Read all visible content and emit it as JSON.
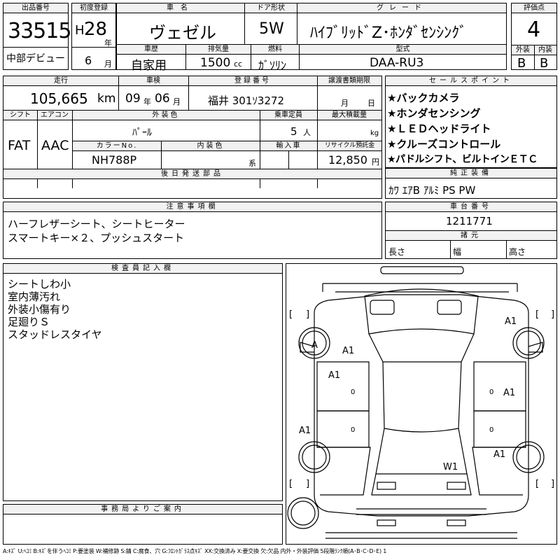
{
  "header_row": {
    "lot_no_label": "出品番号",
    "lot_no": "33515",
    "first_reg_label": "初度登録",
    "era": "H",
    "year": "28",
    "year_unit": "年",
    "month": "6",
    "month_unit": "月",
    "debut": "中部デビュー",
    "car_name_label": "車名",
    "car_name": "ヴェゼル",
    "door_label": "ドア形状",
    "door": "5W",
    "grade_label": "グレード",
    "grade": "ﾊｲﾌﾞﾘｯﾄﾞZ･ﾎﾝﾀﾞｾﾝｼﾝｸﾞ",
    "score_label": "評価点",
    "score": "4",
    "history_label": "車歴",
    "history": "自家用",
    "displacement_label": "排気量",
    "displacement": "1500",
    "displacement_unit": "cc",
    "fuel_label": "燃料",
    "fuel": "ｶﾞｿﾘﾝ",
    "model_label": "型式",
    "model": "DAA-RU3",
    "exterior_label": "外装",
    "exterior": "B",
    "interior_label": "内装",
    "interior": "B"
  },
  "second_block": {
    "mileage_label": "走行",
    "mileage": "105,665",
    "mileage_unit": "km",
    "inspection_label": "車検",
    "insp_year": "09",
    "insp_year_unit": "年",
    "insp_month": "06",
    "insp_month_unit": "月",
    "reg_no_label": "登録番号",
    "reg_no": "福井 301ｿ3272",
    "doc_deadline_label": "譲渡書類期限",
    "doc_month_unit": "月",
    "doc_day_unit": "日",
    "shift_label": "シフト",
    "shift": "FAT",
    "ac_label": "エアコン",
    "ac": "AAC",
    "ext_color_label": "外装色",
    "ext_color": "ﾊﾟｰﾙ",
    "capacity_label": "乗車定員",
    "capacity": "5",
    "capacity_unit": "人",
    "max_load_label": "最大積載量",
    "max_load_unit": "kg",
    "color_no_label": "カラーNo.",
    "color_no": "NH788P",
    "int_color_label": "内装色",
    "int_color_unit": "系",
    "import_label": "輸入車",
    "recycle_label": "リサイクル預託金",
    "recycle": "12,850",
    "recycle_unit": "円",
    "later_parts_label": "後日発送部品"
  },
  "sales_points": {
    "label": "セールスポイント",
    "items": [
      "★バックカメラ",
      "★ホンダセンシング",
      "★ＬＥＤヘッドライト",
      "★クルーズコントロール",
      "★パドルシフト、ビルトインＥＴＣ"
    ]
  },
  "equipment": {
    "label": "純正装備",
    "value": "ｶﾜ ｴｱB ｱﾙﾐ PS PW"
  },
  "notes": {
    "label": "注意事項欄",
    "lines": [
      "ハーフレザーシート、シートヒーター",
      "スマートキー×２、プッシュスタート"
    ]
  },
  "chassis": {
    "label": "車台番号",
    "value": "1211771",
    "spec_label": "諸元",
    "length_label": "長さ",
    "width_label": "幅",
    "height_label": "高さ"
  },
  "inspector": {
    "label": "検査員記入欄",
    "lines": [
      "シートしわ小",
      "室内薄汚れ",
      "外装小傷有り",
      "足廻りＳ",
      "スタッドレスタイヤ"
    ]
  },
  "office": {
    "label": "事務局よりご案内"
  },
  "diagram": {
    "marks": [
      "A",
      "A1",
      "A1",
      "A1",
      "A1",
      "A1",
      "A1",
      "W1",
      "0",
      "0",
      "0",
      "0"
    ],
    "bracket_open": "[",
    "bracket_close": "]"
  },
  "legend": "A:ｷｽﾞ U:ﾍｺﾐ B:ｷｽﾞを伴うﾍｺﾐ P:要塗装 W:補修跡 S:錆 C:腐食、穴 G:ﾌﾛﾝﾄｶﾞﾗｽ点ｷｽﾞ XX:交換済み X:要交換 欠:欠品 内外・外装評価 5段階ﾗﾝｸ順(A･B･C･D･E) 1"
}
